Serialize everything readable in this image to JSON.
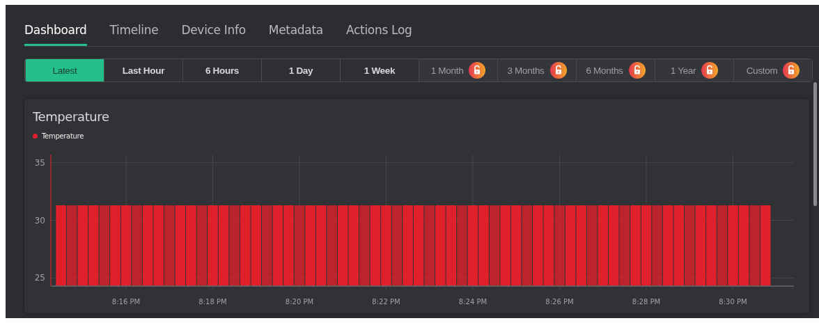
{
  "tabs": [
    {
      "label": "Dashboard",
      "selected": true
    },
    {
      "label": "Timeline",
      "selected": false
    },
    {
      "label": "Device Info",
      "selected": false
    },
    {
      "label": "Metadata",
      "selected": false
    },
    {
      "label": "Actions Log",
      "selected": false
    }
  ],
  "ranges": [
    {
      "label": "Latest",
      "selected": true,
      "locked": false
    },
    {
      "label": "Last Hour",
      "selected": false,
      "locked": false
    },
    {
      "label": "6 Hours",
      "selected": false,
      "locked": false
    },
    {
      "label": "1 Day",
      "selected": false,
      "locked": false
    },
    {
      "label": "1 Week",
      "selected": false,
      "locked": false
    },
    {
      "label": "1 Month",
      "selected": false,
      "locked": true
    },
    {
      "label": "3 Months",
      "selected": false,
      "locked": true
    },
    {
      "label": "6 Months",
      "selected": false,
      "locked": true
    },
    {
      "label": "1 Year",
      "selected": false,
      "locked": true
    },
    {
      "label": "Custom",
      "selected": false,
      "locked": true
    }
  ],
  "card": {
    "title": "Temperature",
    "chart_data": {
      "type": "bar",
      "categories": [
        null,
        null,
        null,
        null,
        null,
        null,
        "8:16 PM",
        null,
        null,
        null,
        null,
        null,
        null,
        null,
        "8:18 PM",
        null,
        null,
        null,
        null,
        null,
        null,
        null,
        "8:20 PM",
        null,
        null,
        null,
        null,
        null,
        null,
        null,
        "8:22 PM",
        null,
        null,
        null,
        null,
        null,
        null,
        null,
        "8:24 PM",
        null,
        null,
        null,
        null,
        null,
        null,
        null,
        "8:26 PM",
        null,
        null,
        null,
        null,
        null,
        null,
        null,
        "8:28 PM",
        null,
        null,
        null,
        null,
        null,
        null,
        null,
        "8:30 PM",
        null,
        null,
        null
      ],
      "series": [
        {
          "name": "Temperature",
          "color": "#e0202a",
          "values": [
            31.3,
            31.3,
            31.3,
            31.3,
            31.3,
            31.3,
            31.3,
            31.3,
            31.3,
            31.3,
            31.3,
            31.3,
            31.3,
            31.3,
            31.3,
            31.3,
            31.3,
            31.3,
            31.3,
            31.3,
            31.3,
            31.3,
            31.3,
            31.3,
            31.3,
            31.3,
            31.3,
            31.3,
            31.3,
            31.3,
            31.3,
            31.3,
            31.3,
            31.3,
            31.3,
            31.3,
            31.3,
            31.3,
            31.3,
            31.3,
            31.3,
            31.3,
            31.3,
            31.3,
            31.3,
            31.3,
            31.3,
            31.3,
            31.3,
            31.3,
            31.3,
            31.3,
            31.3,
            31.3,
            31.3,
            31.3,
            31.3,
            31.3,
            31.3,
            31.3,
            31.3,
            31.3,
            31.3,
            31.3,
            31.3,
            31.3
          ]
        }
      ],
      "ylim": [
        24.3,
        35.7
      ],
      "yticks": [
        25,
        30,
        35
      ],
      "grid": true
    }
  }
}
